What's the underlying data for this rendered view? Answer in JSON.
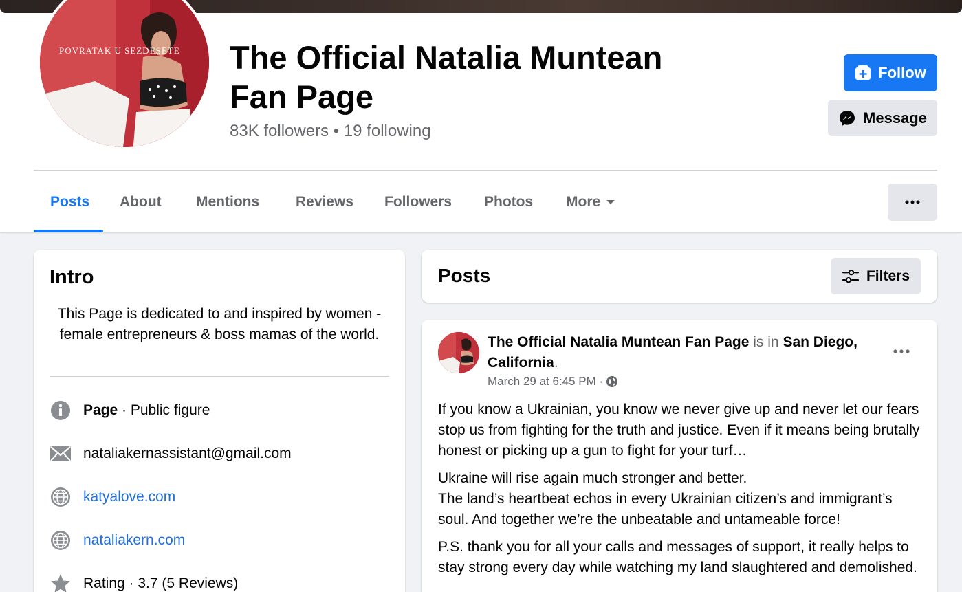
{
  "page": {
    "title": "The Official Natalia Muntean Fan Page",
    "stats": "83K followers • 19 following",
    "avatar_cover_text": "POVRATAK U SEZDESETE"
  },
  "actions": {
    "follow_label": "Follow",
    "message_label": "Message"
  },
  "tabs": [
    {
      "label": "Posts",
      "active": true
    },
    {
      "label": "About"
    },
    {
      "label": "Mentions"
    },
    {
      "label": "Reviews"
    },
    {
      "label": "Followers"
    },
    {
      "label": "Photos"
    },
    {
      "label": "More"
    }
  ],
  "intro": {
    "title": "Intro",
    "bio": "This Page is dedicated to and inspired by women - female entrepreneurs & boss mamas of the world.",
    "page_type_bold": "Page",
    "page_type": " · Public figure",
    "email": "nataliakernassistant@gmail.com",
    "website_1": "katyalove.com",
    "website_2": "nataliakern.com",
    "rating": "Rating · 3.7 (5 Reviews)"
  },
  "posts_header": {
    "title": "Posts",
    "filters_label": "Filters"
  },
  "post": {
    "author": "The Official Natalia Muntean Fan Page",
    "is_in": " is in ",
    "location": "San Diego, California",
    "period": ".",
    "timestamp": "March 29 at 6:45 PM ·",
    "paragraph_1": "If you know a Ukrainian, you know we never give up and never let our fears stop us from fighting for the truth and justice. Even if it means being brutally honest or picking up a gun to fight for your turf…",
    "paragraph_2_line_1": "Ukraine will rise again much stronger and better.",
    "paragraph_2_line_2": "The land’s heartbeat echos in every Ukrainian citizen’s and immigrant’s soul. And together we’re the unbeatable and untameable  force!",
    "paragraph_3": "P.S. thank you for all your calls and messages of support, it really helps to stay strong every day while watching my land slaughtered and demolished."
  },
  "colors": {
    "accent": "#1877f2",
    "link": "#216fdb",
    "muted": "#65676b",
    "background": "#f0f2f5"
  }
}
